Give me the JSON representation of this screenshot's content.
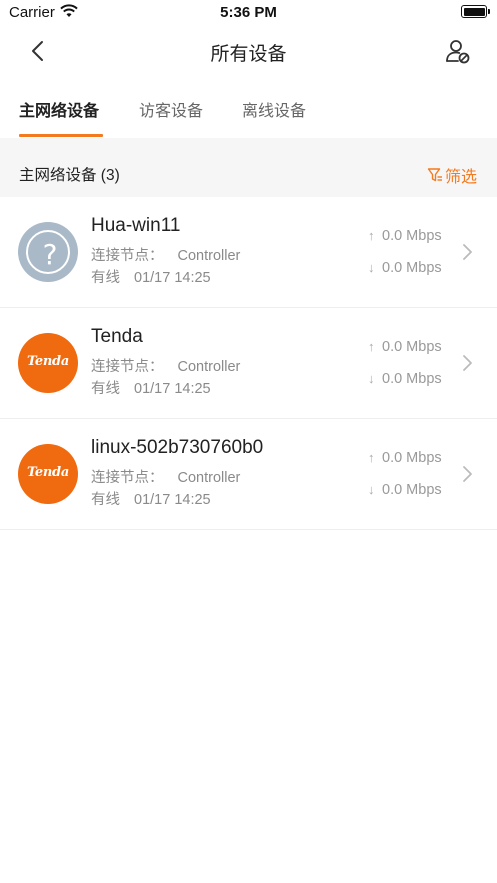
{
  "status_bar": {
    "carrier": "Carrier",
    "time": "5:36 PM"
  },
  "nav": {
    "title": "所有设备",
    "back_icon": "chevron-left-icon",
    "user_icon": "user-settings-icon"
  },
  "tabs": [
    {
      "label": "主网络设备",
      "active": true
    },
    {
      "label": "访客设备",
      "active": false
    },
    {
      "label": "离线设备",
      "active": false
    }
  ],
  "section": {
    "title": "主网络设备 (3)",
    "filter_label": "筛选",
    "filter_icon": "filter-icon"
  },
  "colors": {
    "accent": "#f47a1f",
    "tenda_brand": "#f06a0f",
    "unknown_avatar": "#a9b9c8"
  },
  "devices": [
    {
      "name": "Hua-win11",
      "avatar": "unknown-device-icon",
      "node_label": "连接节点：",
      "node_value": "Controller",
      "connection": "有线",
      "time": "01/17 14:25",
      "upload": "0.0 Mbps",
      "download": "0.0 Mbps"
    },
    {
      "name": "Tenda",
      "avatar": "tenda-logo-icon",
      "brand_text": "Tenda",
      "node_label": "连接节点：",
      "node_value": "Controller",
      "connection": "有线",
      "time": "01/17 14:25",
      "upload": "0.0 Mbps",
      "download": "0.0 Mbps"
    },
    {
      "name": "linux-502b730760b0",
      "avatar": "tenda-logo-icon",
      "brand_text": "Tenda",
      "node_label": "连接节点：",
      "node_value": "Controller",
      "connection": "有线",
      "time": "01/17 14:25",
      "upload": "0.0 Mbps",
      "download": "0.0 Mbps"
    }
  ]
}
